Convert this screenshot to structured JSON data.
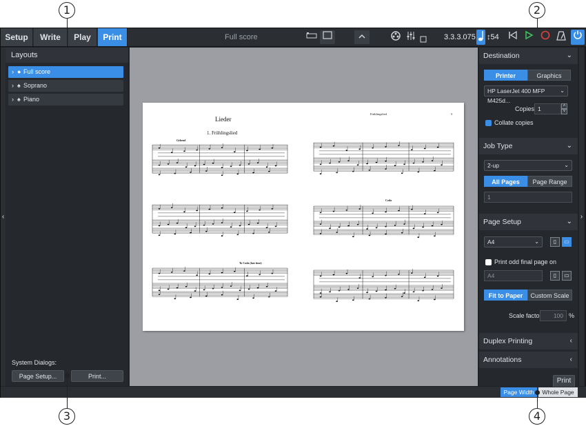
{
  "callouts": [
    "1",
    "2",
    "3",
    "4"
  ],
  "modes": [
    {
      "label": "Setup"
    },
    {
      "label": "Write"
    },
    {
      "label": "Play"
    },
    {
      "label": "Print"
    }
  ],
  "toolbar": {
    "score_title": "Full score",
    "position": "3.3.3.075",
    "tempo_value": "54"
  },
  "layouts": {
    "header": "Layouts",
    "items": [
      {
        "label": "Full score"
      },
      {
        "label": "Soprano"
      },
      {
        "label": "Piano"
      }
    ]
  },
  "system_dialogs": {
    "label": "System Dialogs:",
    "page_setup": "Page Setup...",
    "print": "Print..."
  },
  "destination": {
    "header": "Destination",
    "printer": "Printer",
    "graphics": "Graphics",
    "printer_name": "HP LaserJet 400 MFP M425d...",
    "copies_label": "Copies",
    "copies_value": "1",
    "collate": "Collate copies"
  },
  "job_type": {
    "header": "Job Type",
    "value": "2-up",
    "all_pages": "All Pages",
    "page_range": "Page Range",
    "range_placeholder": "1"
  },
  "page_setup": {
    "header": "Page Setup",
    "size": "A4",
    "odd_final": "Print odd final page on",
    "odd_size": "A4",
    "fit_to_paper": "Fit to Paper",
    "custom_scale": "Custom Scale",
    "scale_label": "Scale factor",
    "scale_value": "100",
    "scale_unit": "%"
  },
  "duplex": {
    "header": "Duplex Printing"
  },
  "annotations": {
    "header": "Annotations"
  },
  "print_button": "Print",
  "statusbar": {
    "page_width": "Page Width",
    "whole_page": "Whole Page"
  },
  "score": {
    "title": "Lieder",
    "piece": "1. Frühlingslied",
    "running_header": "Frühlingslied",
    "page_num": "3",
    "tempo_mark": "Gehend",
    "coda": "Coda",
    "to_coda": "To Coda (last time)"
  }
}
